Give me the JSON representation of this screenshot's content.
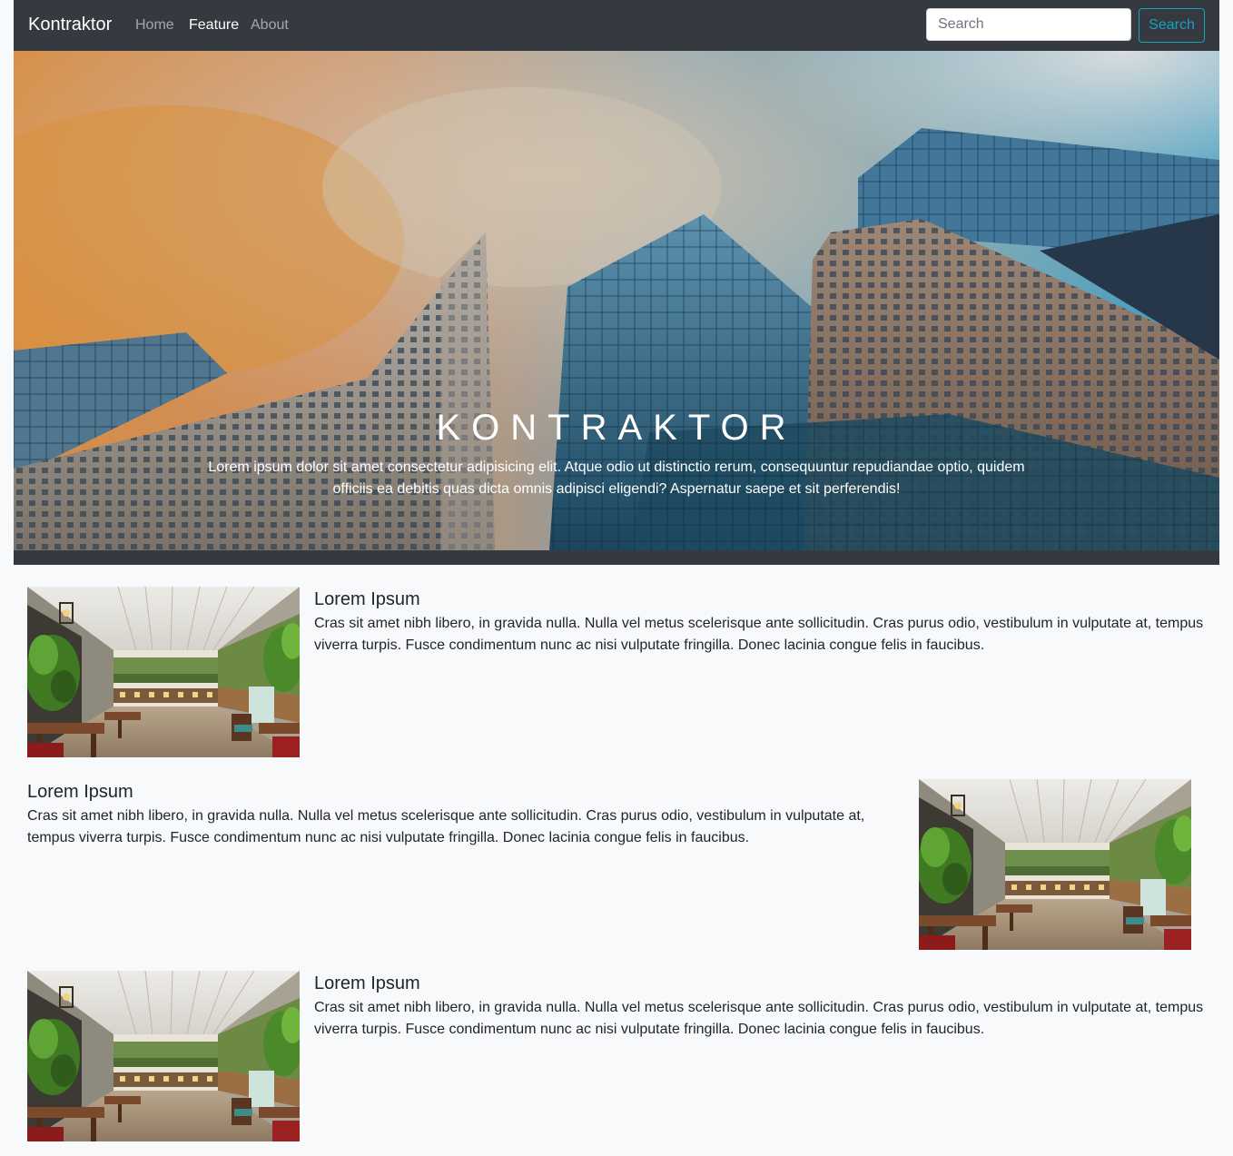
{
  "navbar": {
    "brand": "Kontraktor",
    "links": [
      {
        "label": "Home",
        "active": false
      },
      {
        "label": "Feature",
        "active": true
      },
      {
        "label": "About",
        "active": false
      }
    ],
    "search_placeholder": "Search",
    "search_button": "Search"
  },
  "hero": {
    "title": "KONTRAKTOR",
    "text": "Lorem ipsum dolor sit amet consectetur adipisicing elit. Atque odio ut distinctio rerum, consequuntur repudiandae optio, quidem officiis ea debitis quas dicta omnis adipisci eligendi? Aspernatur saepe et sit perferendis!"
  },
  "features": [
    {
      "title": "Lorem Ipsum",
      "text": "Cras sit amet nibh libero, in gravida nulla. Nulla vel metus scelerisque ante sollicitudin. Cras purus odio, vestibulum in vulputate at, tempus viverra turpis. Fusce condimentum nunc ac nisi vulputate fringilla. Donec lacinia congue felis in faucibus."
    },
    {
      "title": "Lorem Ipsum",
      "text": "Cras sit amet nibh libero, in gravida nulla. Nulla vel metus scelerisque ante sollicitudin. Cras purus odio, vestibulum in vulputate at, tempus viverra turpis. Fusce condimentum nunc ac nisi vulputate fringilla. Donec lacinia congue felis in faucibus."
    },
    {
      "title": "Lorem Ipsum",
      "text": "Cras sit amet nibh libero, in gravida nulla. Nulla vel metus scelerisque ante sollicitudin. Cras purus odio, vestibulum in vulputate at, tempus viverra turpis. Fusce condimentum nunc ac nisi vulputate fringilla. Donec lacinia congue felis in faucibus."
    }
  ]
}
